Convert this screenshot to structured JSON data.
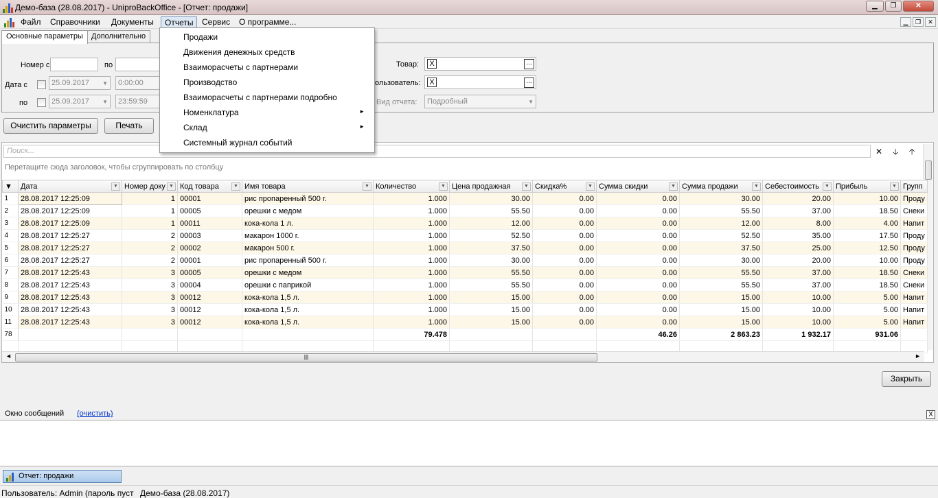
{
  "window": {
    "title": "Демо-база (28.08.2017)  - UniproBackOffice  - [Отчет: продажи]",
    "minimize": "▁",
    "maximize": "❐",
    "close": "✕"
  },
  "menu": {
    "items": [
      "Файл",
      "Справочники",
      "Документы",
      "Отчеты",
      "Сервис",
      "О программе..."
    ],
    "active": "Отчеты"
  },
  "mdi_buttons": [
    "▁",
    "❐",
    "✕"
  ],
  "reports_menu": [
    {
      "label": "Продажи",
      "submenu": false
    },
    {
      "label": "Движения денежных средств",
      "submenu": false
    },
    {
      "label": "Взаиморасчеты с партнерами",
      "submenu": false
    },
    {
      "label": "Производство",
      "submenu": false
    },
    {
      "label": "Взаиморасчеты с партнерами подробно",
      "submenu": false
    },
    {
      "label": "Номенклатура",
      "submenu": true
    },
    {
      "label": "Склад",
      "submenu": true
    },
    {
      "label": "Системный журнал событий",
      "submenu": false
    }
  ],
  "tabs": [
    "Основные параметры",
    "Дополнительно"
  ],
  "params": {
    "number_from_label": "Номер с",
    "number_to_label": "по",
    "date_from_label": "Дата с",
    "date_to_label": "по",
    "date_from": "25.09.2017",
    "time_from": "0:00:00",
    "date_to": "25.09.2017",
    "time_to": "23:59:59",
    "product_label": "Товар:",
    "user_label": "пользователь:",
    "report_type_label": "Вид отчета:",
    "report_type_value": "Подробный",
    "checkbox_x": "X",
    "dots": "..."
  },
  "buttons": {
    "clear_params": "Очистить параметры",
    "print": "Печать",
    "close": "Закрыть"
  },
  "grid": {
    "search_placeholder": "Поиск...",
    "group_hint": "Перетащите сюда заголовок, чтобы сгруппировать по столбцу",
    "search_icons": [
      "✕",
      "🡣",
      "🡡"
    ],
    "columns": [
      "Дата",
      "Номер доку",
      "Код товара",
      "Имя товара",
      "Количество",
      "Цена продажная",
      "Скидка%",
      "Сумма скидки",
      "Сумма продажи",
      "Себестоимость",
      "Прибыль",
      "Групп"
    ],
    "rows": [
      {
        "n": "1",
        "date": "28.08.2017 12:25:09",
        "doc": "1",
        "code": "00001",
        "name": "рис пропаренный 500 г.",
        "qty": "1.000",
        "price": "30.00",
        "disc_pct": "0.00",
        "disc_sum": "0.00",
        "sale_sum": "30.00",
        "cost": "20.00",
        "profit": "10.00",
        "group": "Проду"
      },
      {
        "n": "2",
        "date": "28.08.2017 12:25:09",
        "doc": "1",
        "code": "00005",
        "name": "орешки с медом",
        "qty": "1.000",
        "price": "55.50",
        "disc_pct": "0.00",
        "disc_sum": "0.00",
        "sale_sum": "55.50",
        "cost": "37.00",
        "profit": "18.50",
        "group": "Снеки"
      },
      {
        "n": "3",
        "date": "28.08.2017 12:25:09",
        "doc": "1",
        "code": "00011",
        "name": "кока-кола 1 л.",
        "qty": "1.000",
        "price": "12.00",
        "disc_pct": "0.00",
        "disc_sum": "0.00",
        "sale_sum": "12.00",
        "cost": "8.00",
        "profit": "4.00",
        "group": "Напит"
      },
      {
        "n": "4",
        "date": "28.08.2017 12:25:27",
        "doc": "2",
        "code": "00003",
        "name": "макарон 1000 г.",
        "qty": "1.000",
        "price": "52.50",
        "disc_pct": "0.00",
        "disc_sum": "0.00",
        "sale_sum": "52.50",
        "cost": "35.00",
        "profit": "17.50",
        "group": "Проду"
      },
      {
        "n": "5",
        "date": "28.08.2017 12:25:27",
        "doc": "2",
        "code": "00002",
        "name": "макарон 500 г.",
        "qty": "1.000",
        "price": "37.50",
        "disc_pct": "0.00",
        "disc_sum": "0.00",
        "sale_sum": "37.50",
        "cost": "25.00",
        "profit": "12.50",
        "group": "Проду"
      },
      {
        "n": "6",
        "date": "28.08.2017 12:25:27",
        "doc": "2",
        "code": "00001",
        "name": "рис пропаренный 500 г.",
        "qty": "1.000",
        "price": "30.00",
        "disc_pct": "0.00",
        "disc_sum": "0.00",
        "sale_sum": "30.00",
        "cost": "20.00",
        "profit": "10.00",
        "group": "Проду"
      },
      {
        "n": "7",
        "date": "28.08.2017 12:25:43",
        "doc": "3",
        "code": "00005",
        "name": "орешки с медом",
        "qty": "1.000",
        "price": "55.50",
        "disc_pct": "0.00",
        "disc_sum": "0.00",
        "sale_sum": "55.50",
        "cost": "37.00",
        "profit": "18.50",
        "group": "Снеки"
      },
      {
        "n": "8",
        "date": "28.08.2017 12:25:43",
        "doc": "3",
        "code": "00004",
        "name": "орешки с паприкой",
        "qty": "1.000",
        "price": "55.50",
        "disc_pct": "0.00",
        "disc_sum": "0.00",
        "sale_sum": "55.50",
        "cost": "37.00",
        "profit": "18.50",
        "group": "Снеки"
      },
      {
        "n": "9",
        "date": "28.08.2017 12:25:43",
        "doc": "3",
        "code": "00012",
        "name": "кока-кола 1,5 л.",
        "qty": "1.000",
        "price": "15.00",
        "disc_pct": "0.00",
        "disc_sum": "0.00",
        "sale_sum": "15.00",
        "cost": "10.00",
        "profit": "5.00",
        "group": "Напит"
      },
      {
        "n": "10",
        "date": "28.08.2017 12:25:43",
        "doc": "3",
        "code": "00012",
        "name": "кока-кола 1,5 л.",
        "qty": "1.000",
        "price": "15.00",
        "disc_pct": "0.00",
        "disc_sum": "0.00",
        "sale_sum": "15.00",
        "cost": "10.00",
        "profit": "5.00",
        "group": "Напит"
      },
      {
        "n": "11",
        "date": "28.08.2017 12:25:43",
        "doc": "3",
        "code": "00012",
        "name": "кока-кола 1,5 л.",
        "qty": "1.000",
        "price": "15.00",
        "disc_pct": "0.00",
        "disc_sum": "0.00",
        "sale_sum": "15.00",
        "cost": "10.00",
        "profit": "5.00",
        "group": "Напит"
      }
    ],
    "totals": {
      "n": "78",
      "qty": "79.478",
      "disc_sum": "46.26",
      "sale_sum": "2 863.23",
      "cost": "1 932.17",
      "profit": "931.06"
    },
    "hscroll_grip": "|||"
  },
  "messages": {
    "label": "Окно сообщений",
    "clear": "(очистить)",
    "close": "X"
  },
  "taskbar": {
    "button": "Отчет: продажи"
  },
  "status": {
    "user": "Пользователь: Admin (пароль пуст",
    "db": "Демо-база (28.08.2017)"
  },
  "colors": {
    "accent": "#7a96bd",
    "row_alt": "#fdf7e7"
  }
}
